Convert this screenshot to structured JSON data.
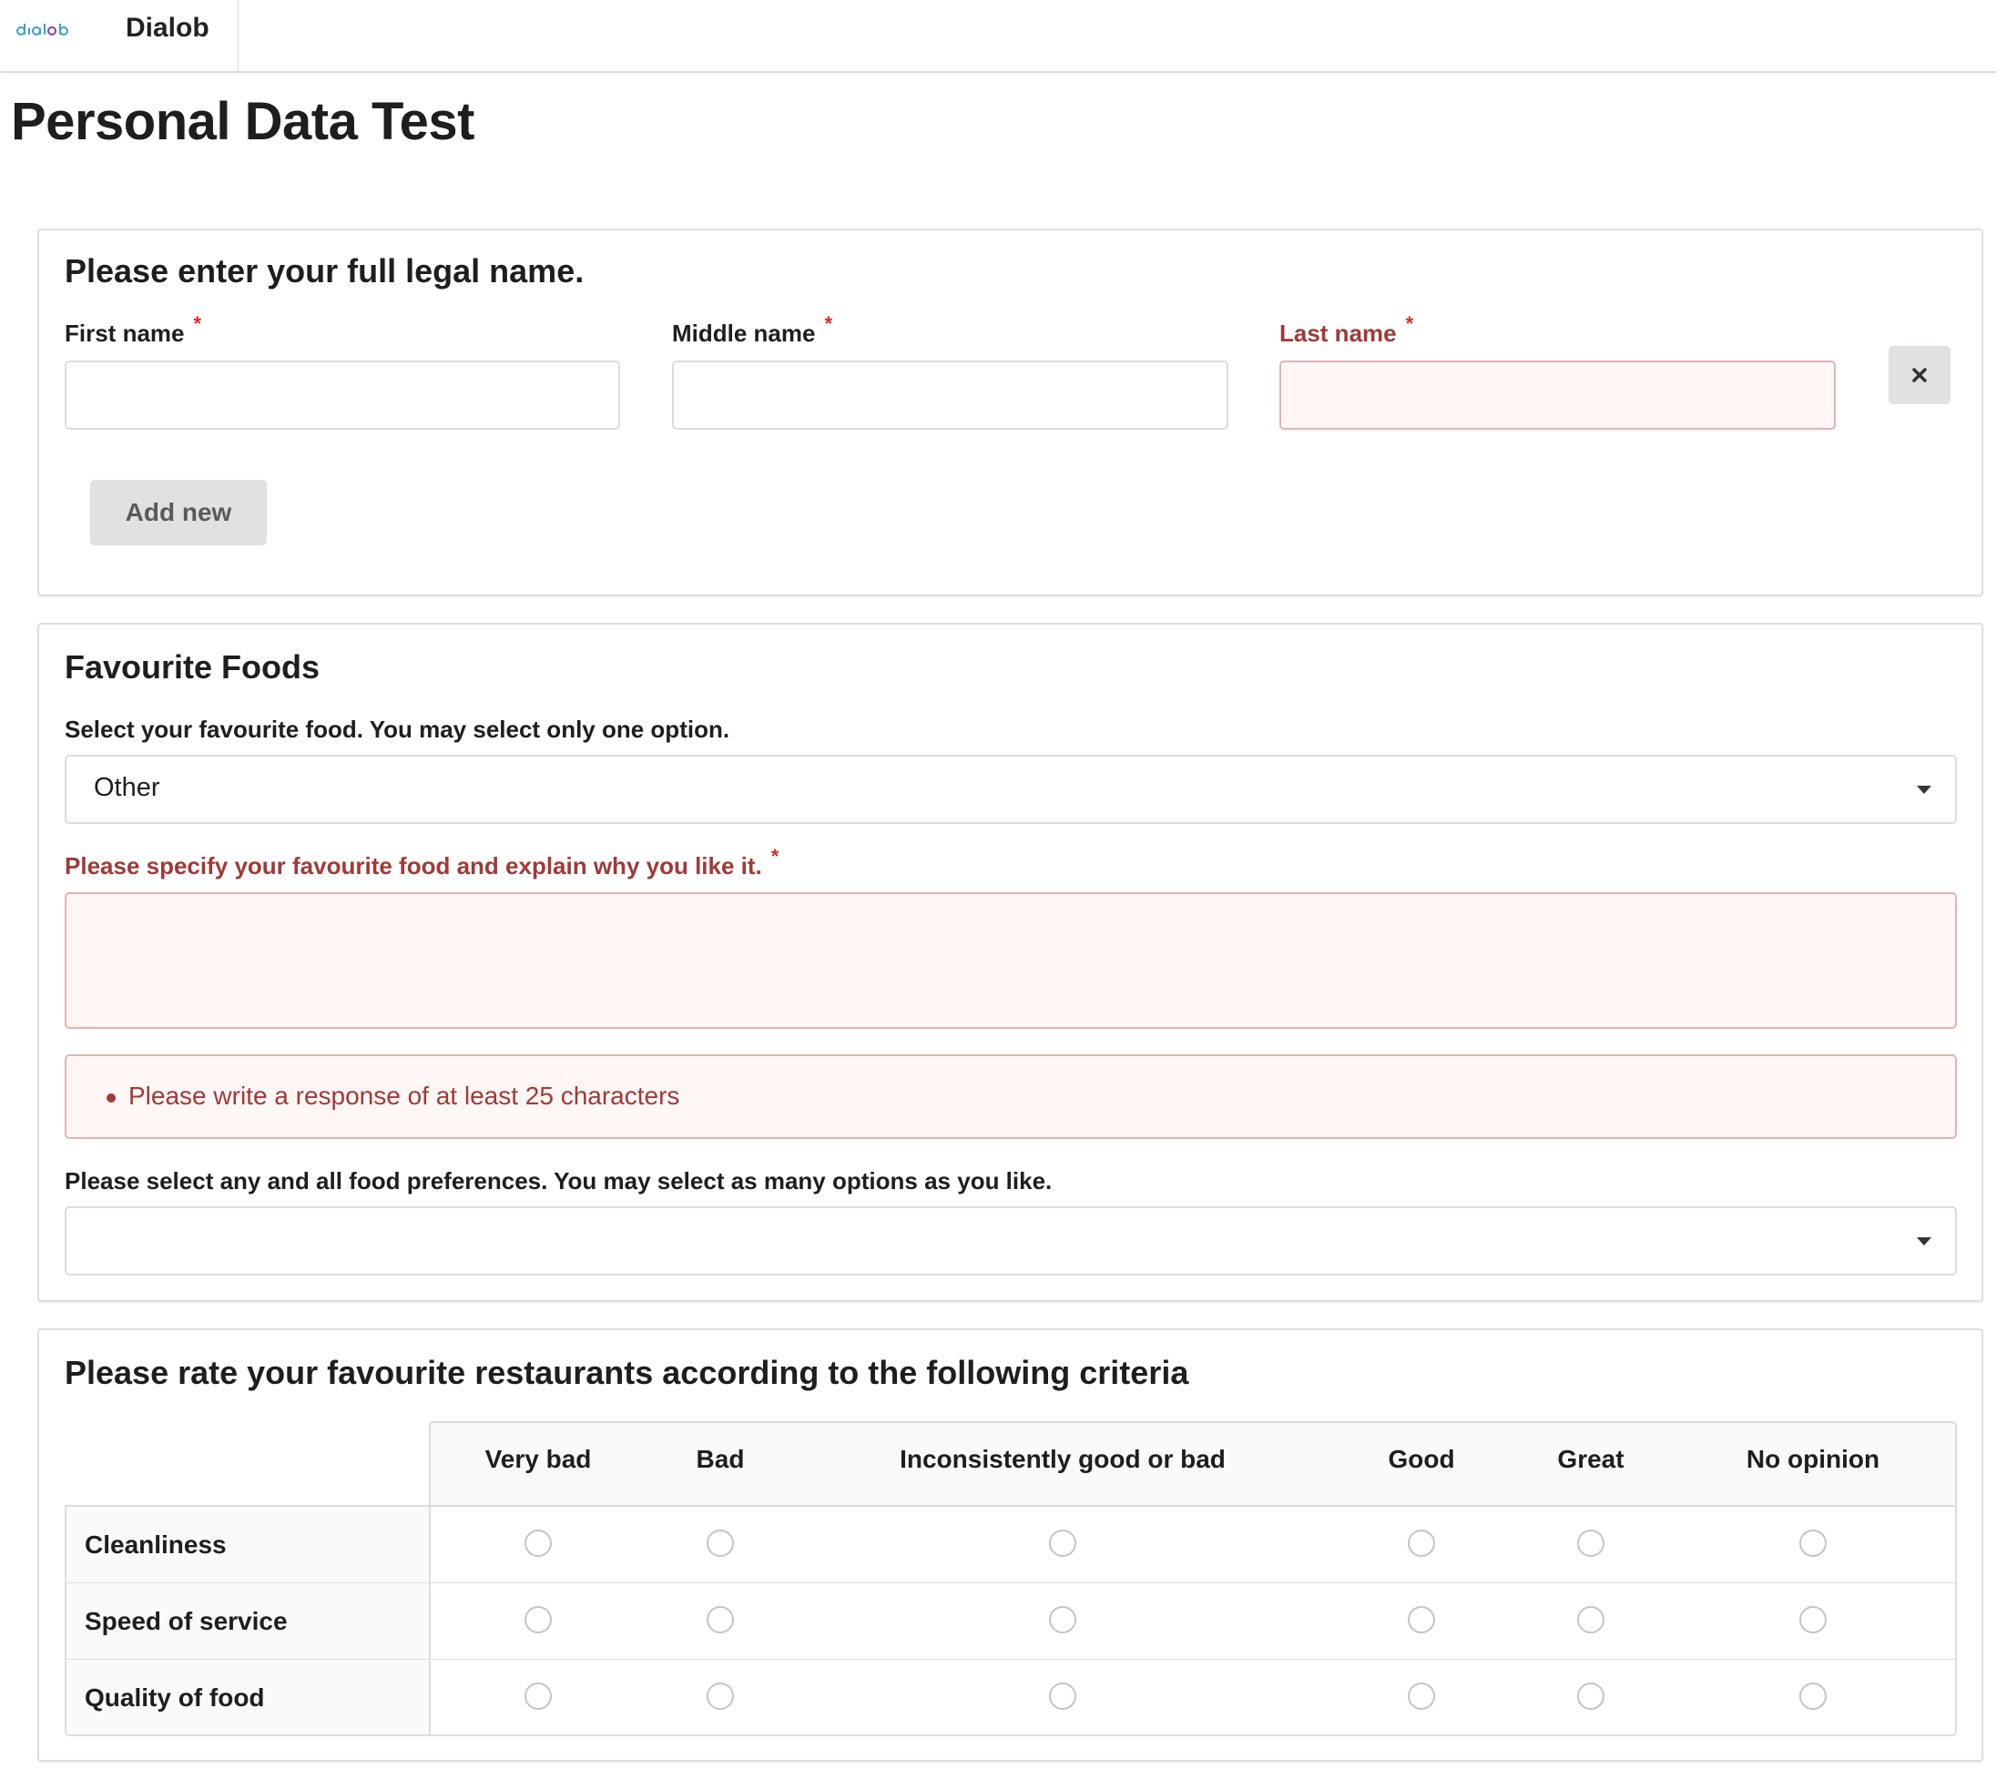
{
  "app": {
    "logo_text": "dialob",
    "brand": "Dialob"
  },
  "page": {
    "title": "Personal Data Test"
  },
  "name_section": {
    "title": "Please enter your full legal name.",
    "fields": [
      {
        "label": "First name",
        "value": "",
        "required": true,
        "error": false
      },
      {
        "label": "Middle name",
        "value": "",
        "required": true,
        "error": false
      },
      {
        "label": "Last name",
        "value": "",
        "required": true,
        "error": true
      }
    ],
    "required_marker": "*",
    "add_new_label": "Add new",
    "remove_icon": "close-icon"
  },
  "foods_section": {
    "title": "Favourite Foods",
    "single_select": {
      "label": "Select your favourite food. You may select only one option.",
      "value": "Other"
    },
    "specify": {
      "label": "Please specify your favourite food and explain why you like it.",
      "value": "",
      "required": true
    },
    "error_message": "Please write a response of at least 25 characters",
    "multi_select": {
      "label": "Please select any and all food preferences. You may select as many options as you like.",
      "value": ""
    }
  },
  "survey_section": {
    "title": "Please rate your favourite restaurants according to the following criteria",
    "columns": [
      "Very bad",
      "Bad",
      "Inconsistently good or bad",
      "Good",
      "Great",
      "No opinion"
    ],
    "rows": [
      {
        "label": "Cleanliness",
        "selected": null
      },
      {
        "label": "Speed of service",
        "selected": null
      },
      {
        "label": "Quality of food",
        "selected": null
      }
    ]
  },
  "colors": {
    "error_text": "#9f3a38",
    "error_bg": "#fff6f6",
    "error_border": "#e0b4b4",
    "required": "#db2828",
    "button_bg": "#e0e1e2"
  }
}
